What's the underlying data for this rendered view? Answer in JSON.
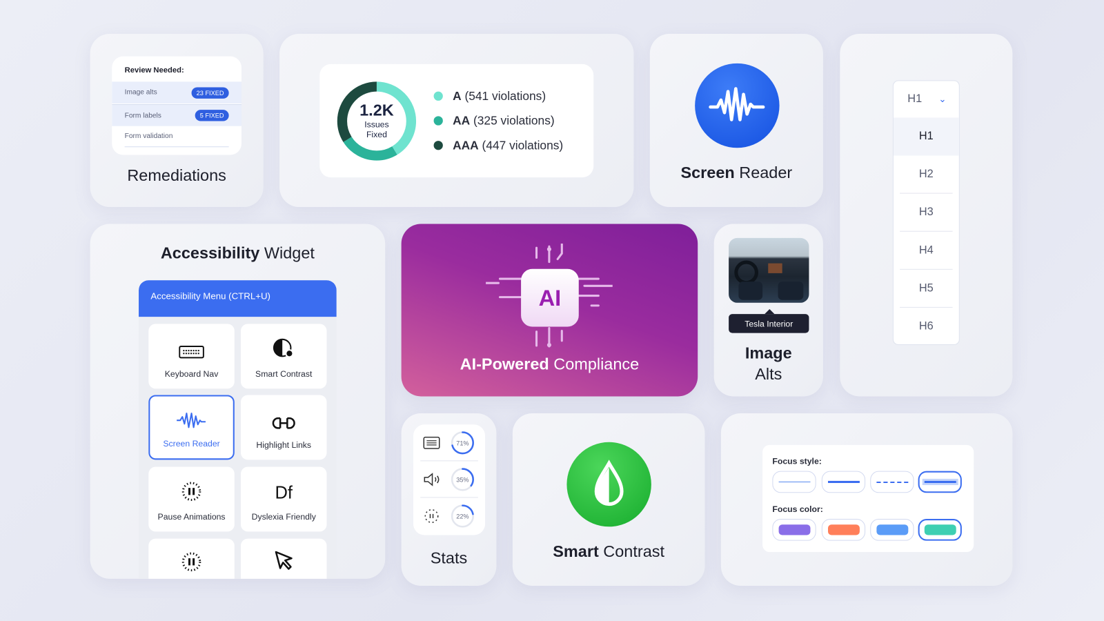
{
  "remediations": {
    "heading": "Review Needed:",
    "rows": [
      {
        "label": "Image alts",
        "badge": "23 FIXED"
      },
      {
        "label": "Form labels",
        "badge": "5 FIXED"
      },
      {
        "label": "Form validation",
        "badge": null
      }
    ],
    "title": "Remediations"
  },
  "issues": {
    "total": "1.2K",
    "line1": "Issues",
    "line2": "Fixed",
    "legend": [
      {
        "level": "A",
        "text": "(541 violations)",
        "value": 541,
        "color": "#6fe3cf"
      },
      {
        "level": "AA",
        "text": "(325 violations)",
        "value": 325,
        "color": "#2bb39a"
      },
      {
        "level": "AAA",
        "text": "(447 violations)",
        "value": 447,
        "color": "#1d4a3f"
      }
    ]
  },
  "screen_reader": {
    "bold": "Screen",
    "rest": " Reader",
    "color": "#1f5de8"
  },
  "headings": {
    "selected": "H1",
    "options": [
      "H1",
      "H2",
      "H3",
      "H4",
      "H5",
      "H6"
    ]
  },
  "widget": {
    "bold": "Accessibility",
    "rest": " Widget",
    "menu_title": "Accessibility Menu (CTRL+U)",
    "tiles": [
      {
        "label": "Keyboard Nav",
        "icon": "keyboard-icon"
      },
      {
        "label": "Smart Contrast",
        "icon": "contrast-icon"
      },
      {
        "label": "Screen Reader",
        "icon": "soundwave-icon",
        "selected": true
      },
      {
        "label": "Highlight Links",
        "icon": "link-icon"
      },
      {
        "label": "Pause Animations",
        "icon": "pause-icon"
      },
      {
        "label": "Dyslexia Friendly",
        "icon": "dyslexia-icon",
        "glyph": "Df"
      },
      {
        "label": "",
        "icon": "pause-icon"
      },
      {
        "label": "",
        "icon": "cursor-icon"
      }
    ]
  },
  "ai": {
    "chip": "AI",
    "bold": "AI-Powered",
    "rest": " Compliance"
  },
  "image_alts": {
    "tooltip": "Tesla Interior",
    "line1": "Image",
    "line2": "Alts"
  },
  "stats": {
    "title": "Stats",
    "rows": [
      {
        "icon": "text-icon",
        "percent": 71,
        "label": "71%"
      },
      {
        "icon": "speaker-icon",
        "percent": 35,
        "label": "35%"
      },
      {
        "icon": "animation-icon",
        "percent": 22,
        "label": "22%"
      }
    ]
  },
  "smart_contrast": {
    "bold": "Smart",
    "rest": " Contrast",
    "color": "#1fb83a"
  },
  "focus": {
    "style_label": "Focus style:",
    "styles": [
      "thin",
      "solid",
      "dashed",
      "glow"
    ],
    "selected_style": "glow",
    "color_label": "Focus color:",
    "colors": [
      "#8a6ee8",
      "#ff7f5a",
      "#5b9cf7",
      "#3ecfb2"
    ],
    "selected_color": "#3ecfb2"
  }
}
